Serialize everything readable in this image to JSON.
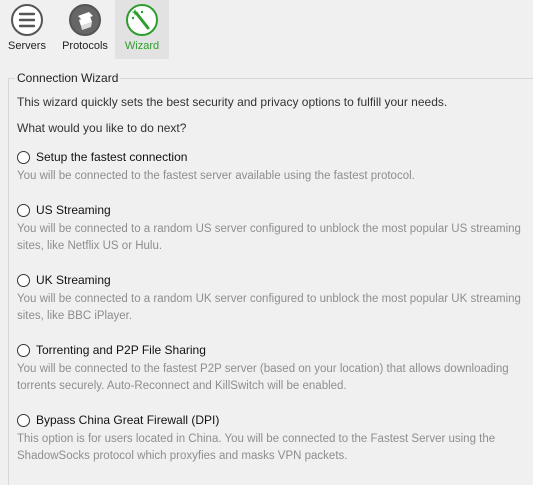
{
  "toolbar": {
    "servers_label": "Servers",
    "protocols_label": "Protocols",
    "wizard_label": "Wizard",
    "accent_color": "#2e9e2e"
  },
  "wizard": {
    "group_title": "Connection Wizard",
    "intro": "This wizard quickly sets the best security and privacy options to fulfill your needs.",
    "question": "What would you like to do next?",
    "options": [
      {
        "label": "Setup the fastest connection",
        "description": "You will be connected to the fastest server available using the fastest protocol.",
        "selected": false
      },
      {
        "label": "US Streaming",
        "description": "You will be connected to a random US server configured to unblock the most popular US streaming sites, like Netflix US or Hulu.",
        "selected": false
      },
      {
        "label": "UK Streaming",
        "description": "You will be connected to a random UK server configured to unblock the most popular UK streaming sites, like BBC iPlayer.",
        "selected": false
      },
      {
        "label": "Torrenting and P2P File Sharing",
        "description": "You will be connected to the fastest P2P server (based on your location) that allows downloading torrents securely. Auto-Reconnect and KillSwitch will be enabled.",
        "selected": false
      },
      {
        "label": "Bypass China Great Firewall (DPI)",
        "description": "This option is for users located in China. You will be connected to the Fastest Server using the ShadowSocks protocol which proxyfies and masks VPN packets.",
        "selected": false
      }
    ]
  }
}
